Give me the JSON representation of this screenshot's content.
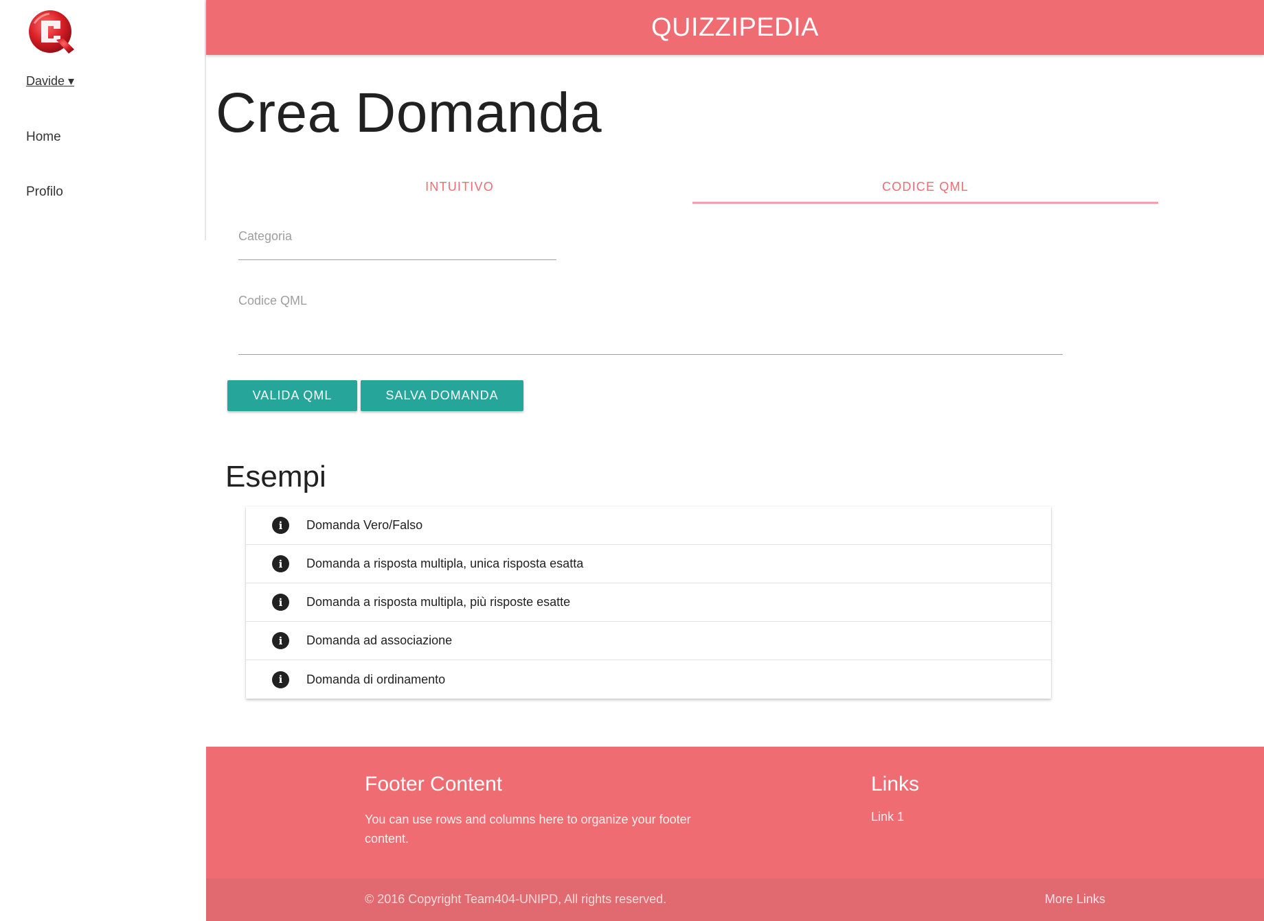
{
  "sidebar": {
    "logo_icon": "quizzipedia-q-logo",
    "user": "Davide ▾",
    "items": [
      {
        "label": "Home"
      },
      {
        "label": "Profilo"
      }
    ]
  },
  "header": {
    "brand": "QUIZZIPEDIA",
    "color": "#ef6c73"
  },
  "main": {
    "title": "Crea Domanda",
    "tabs": [
      {
        "label": "INTUITIVO",
        "active": false
      },
      {
        "label": "CODICE QML",
        "active": true
      }
    ],
    "form": {
      "categoria_label": "Categoria",
      "categoria_value": "",
      "qml_label": "Codice QML",
      "qml_value": ""
    },
    "buttons": {
      "valida": "VALIDA QML",
      "salva": "SALVA DOMANDA",
      "color": "#26a69a"
    },
    "examples": {
      "title": "Esempi",
      "icon": "info-icon",
      "items": [
        {
          "label": "Domanda Vero/Falso"
        },
        {
          "label": "Domanda a risposta multipla, unica risposta esatta"
        },
        {
          "label": "Domanda a risposta multipla, più risposte esatte"
        },
        {
          "label": "Domanda ad associazione"
        },
        {
          "label": "Domanda di ordinamento"
        }
      ]
    }
  },
  "footer": {
    "content_title": "Footer Content",
    "content_text": "You can use rows and columns here to organize your footer content.",
    "links_title": "Links",
    "links": [
      {
        "label": "Link 1"
      }
    ],
    "copyright": "© 2016 Copyright Team404-UNIPD, All rights reserved.",
    "more_links": "More Links"
  }
}
